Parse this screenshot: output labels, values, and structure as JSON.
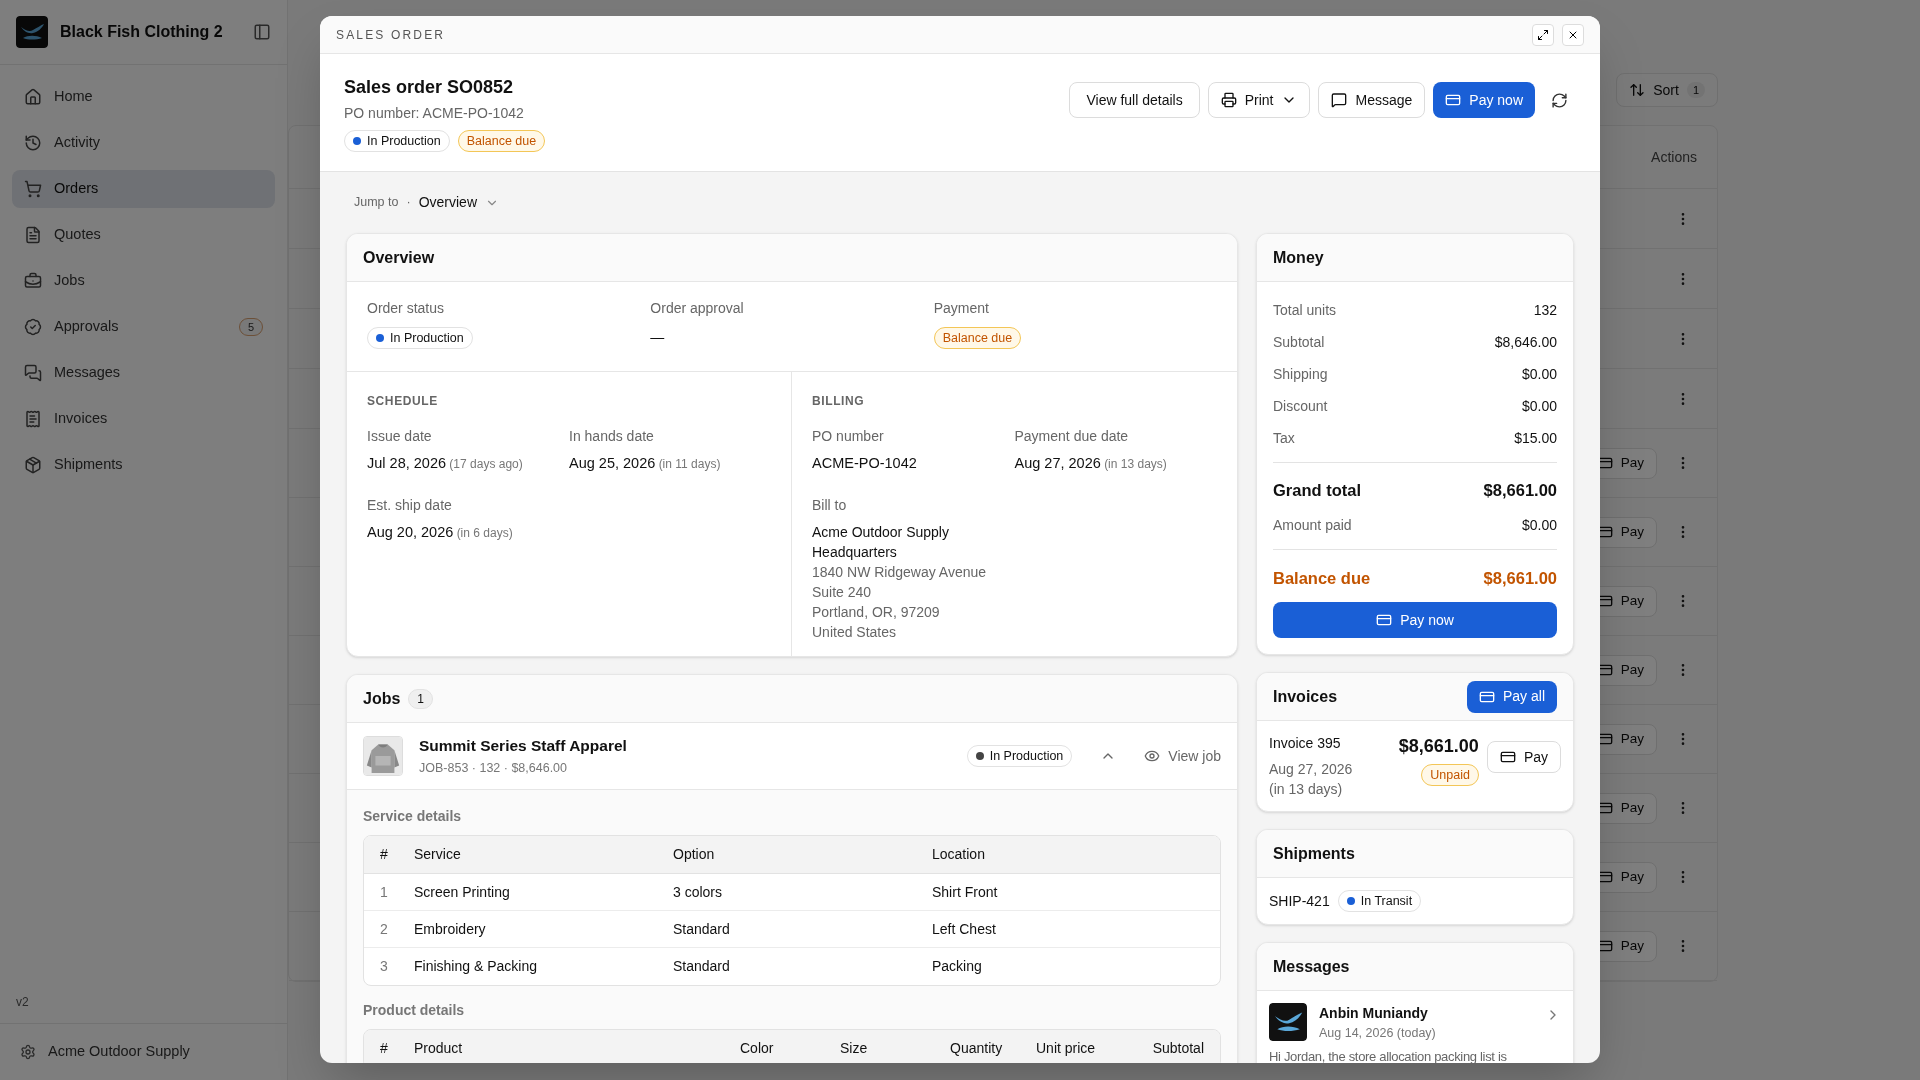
{
  "sidebar": {
    "brand": "Black Fish Clothing 2",
    "items": [
      {
        "label": "Home",
        "selected": false
      },
      {
        "label": "Activity",
        "selected": false
      },
      {
        "label": "Orders",
        "selected": true
      },
      {
        "label": "Quotes",
        "selected": false
      },
      {
        "label": "Jobs",
        "selected": false
      },
      {
        "label": "Approvals",
        "selected": false,
        "badge": "5"
      },
      {
        "label": "Messages",
        "selected": false
      },
      {
        "label": "Invoices",
        "selected": false
      },
      {
        "label": "Shipments",
        "selected": false
      }
    ],
    "version": "v2",
    "account": "Acme Outdoor Supply"
  },
  "orders_list": {
    "sort": {
      "label": "Sort",
      "count": "1"
    },
    "actions_header": "Actions",
    "rows": [
      {
        "kind": "menu"
      },
      {
        "kind": "menu"
      },
      {
        "kind": "menu"
      },
      {
        "kind": "menu"
      },
      {
        "kind": "pay",
        "button": "Pay"
      },
      {
        "kind": "pay",
        "button": "Pay"
      },
      {
        "kind": "pay",
        "button": "Pay"
      },
      {
        "kind": "pay",
        "button": "Pay"
      },
      {
        "kind": "pay",
        "button": "Pay"
      },
      {
        "kind": "pay",
        "button": "Pay"
      },
      {
        "kind": "pay",
        "button": "Pay"
      },
      {
        "kind": "pay",
        "button": "Pay"
      }
    ]
  },
  "dialog": {
    "title": "SALES ORDER",
    "order": {
      "title": "Sales order SO0852",
      "po": "PO number: ACME-PO-1042",
      "badges": [
        {
          "kind": "status",
          "label": "In Production",
          "color": "#1a5fd6"
        },
        {
          "kind": "warning",
          "label": "Balance due"
        }
      ]
    },
    "actions": [
      {
        "kind": "plain",
        "label": "View full details"
      },
      {
        "kind": "print",
        "label": "Print"
      },
      {
        "kind": "message",
        "label": "Message"
      },
      {
        "kind": "primary",
        "label": "Pay now"
      },
      {
        "kind": "refresh"
      }
    ],
    "jump_to": {
      "label": "Jump to",
      "separator": "·",
      "value": "Overview"
    },
    "overview": {
      "title": "Overview",
      "order_status": {
        "label": "Order status",
        "badge": {
          "kind": "status",
          "label": "In Production",
          "color": "#1a5fd6"
        }
      },
      "order_approval": {
        "label": "Order approval",
        "value": "—"
      },
      "payment": {
        "label": "Payment",
        "badge": {
          "kind": "warning",
          "label": "Balance due"
        }
      },
      "schedule": {
        "title": "SCHEDULE",
        "fields": [
          {
            "label": "Issue date",
            "value": "Jul 28, 2026",
            "note": "(17 days ago)"
          },
          {
            "label": "In hands date",
            "value": "Aug 25, 2026",
            "note": "(in 11 days)"
          },
          {
            "label": "Est. ship date",
            "value": "Aug 20, 2026",
            "note": "(in 6 days)"
          }
        ]
      },
      "billing": {
        "title": "BILLING",
        "fields": [
          {
            "label": "PO number",
            "value": "ACME-PO-1042"
          },
          {
            "label": "Payment due date",
            "value": "Aug 27, 2026",
            "note": "(in 13 days)"
          }
        ],
        "bill_to": {
          "label": "Bill to",
          "name": "Acme Outdoor Supply Headquarters",
          "lines": [
            "1840 NW Ridgeway Avenue",
            "Suite 240",
            "Portland, OR, 97209",
            "United States"
          ]
        }
      }
    },
    "jobs": {
      "title": "Jobs",
      "count": "1",
      "items": [
        {
          "name": "Summit Series Staff Apparel",
          "meta": "JOB-853 · 132 · $8,646.00",
          "status": {
            "label": "In Production",
            "color": "#444444"
          },
          "expanded": true,
          "view": "View job",
          "service_details": {
            "title": "Service details",
            "columns": [
              "#",
              "Service",
              "Option",
              "Location"
            ],
            "rows": [
              [
                "1",
                "Screen Printing",
                "3 colors",
                "Shirt Front"
              ],
              [
                "2",
                "Embroidery",
                "Standard",
                "Left Chest"
              ],
              [
                "3",
                "Finishing & Packing",
                "Standard",
                "Packing"
              ]
            ]
          },
          "product_details": {
            "title": "Product details",
            "columns": [
              "#",
              "Product",
              "Color",
              "Size",
              "Quantity",
              "Unit price",
              "Subtotal"
            ]
          }
        }
      ]
    },
    "money": {
      "title": "Money",
      "lines": [
        {
          "label": "Total units",
          "value": "132"
        },
        {
          "label": "Subtotal",
          "value": "$8,646.00"
        },
        {
          "label": "Shipping",
          "value": "$0.00"
        },
        {
          "label": "Discount",
          "value": "$0.00"
        },
        {
          "label": "Tax",
          "value": "$15.00"
        }
      ],
      "grand_total": {
        "label": "Grand total",
        "value": "$8,661.00"
      },
      "amount_paid": {
        "label": "Amount paid",
        "value": "$0.00"
      },
      "balance_due": {
        "label": "Balance due",
        "value": "$8,661.00"
      },
      "button": "Pay now"
    },
    "invoices": {
      "title": "Invoices",
      "pay_all": "Pay all",
      "items": [
        {
          "name": "Invoice 395",
          "date": "Aug 27, 2026",
          "note": "(in 13 days)",
          "amount": "$8,661.00",
          "status": "Unpaid",
          "button": "Pay"
        }
      ]
    },
    "shipments": {
      "title": "Shipments",
      "items": [
        {
          "id": "SHIP-421",
          "status": "In Transit",
          "color": "#1a5fd6"
        }
      ]
    },
    "messages": {
      "title": "Messages",
      "items": [
        {
          "author": "Anbin Muniandy",
          "date": "Aug 14, 2026",
          "note": "(today)",
          "preview": "Hi Jordan, the store allocation packing list is"
        }
      ]
    }
  }
}
